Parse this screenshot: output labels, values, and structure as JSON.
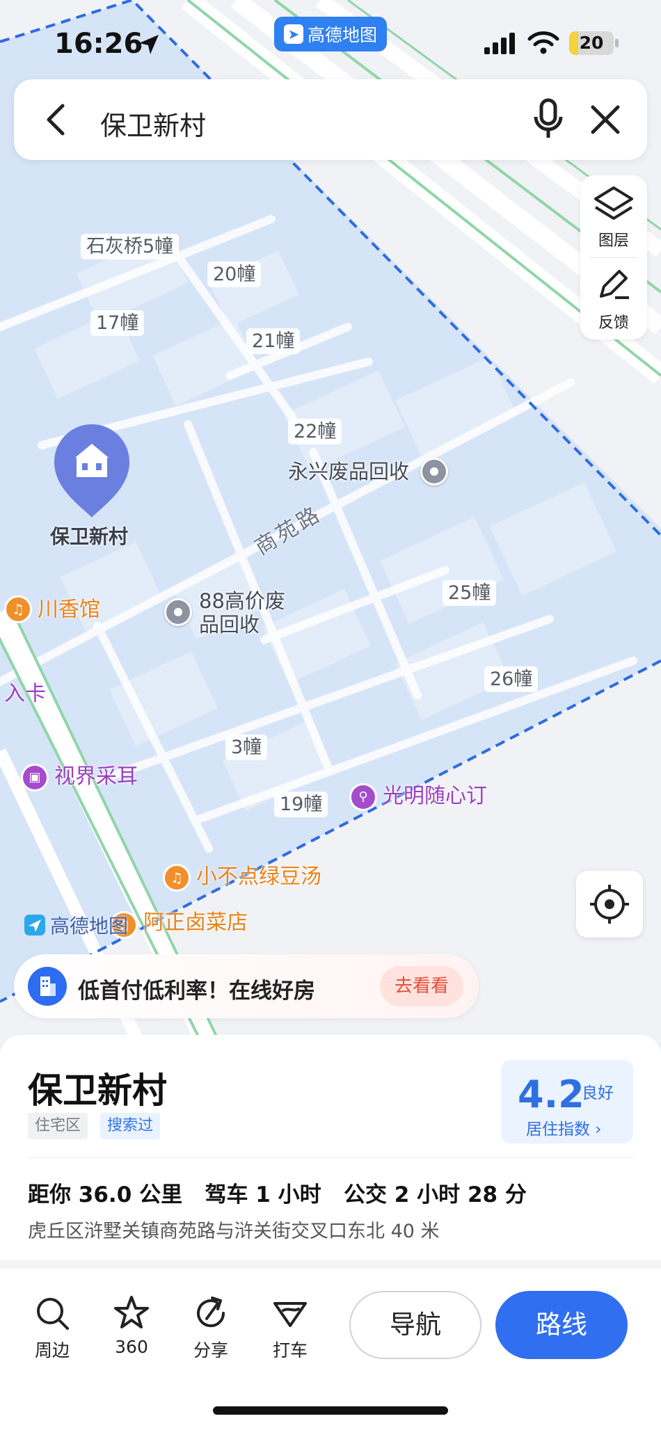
{
  "status_bar": {
    "time": "16:26",
    "app_badge": "高德地图",
    "battery": "20",
    "battery_level": 0.2
  },
  "search": {
    "query": "保卫新村"
  },
  "side_controls": {
    "layers": "图层",
    "feedback": "反馈"
  },
  "map": {
    "buildings": [
      "石灰桥5幢",
      "20幢",
      "17幢",
      "21幢",
      "22幢",
      "25幢",
      "26幢",
      "3幢",
      "19幢"
    ],
    "road_name": "商苑路",
    "pois": {
      "recycle1": "永兴废品回收",
      "recycle2_line1": "88高价废",
      "recycle2_line2": "品回收",
      "restaurant1": "川香馆",
      "edge_label": "入卡",
      "shop1": "视界采耳",
      "shop2": "光明随心订",
      "restaurant2": "小不点绿豆汤",
      "restaurant3": "阿正卤菜店"
    },
    "pin_label": "保卫新村",
    "watermark": "高德地图"
  },
  "ad": {
    "text": "低首付低利率！在线好房",
    "button": "去看看"
  },
  "place": {
    "name": "保卫新村",
    "tags": [
      "住宅区",
      "搜索过"
    ],
    "score": "4.2",
    "score_level": "良好",
    "score_label": "居住指数",
    "distance": "距你 36.0 公里",
    "drive": "驾车 1 小时",
    "transit": "公交 2 小时 28 分",
    "address": "虎丘区浒墅关镇商苑路与浒关街交叉口东北 40 米"
  },
  "actions": {
    "nearby": "周边",
    "panorama": "360",
    "share": "分享",
    "taxi": "打车",
    "navigate": "导航",
    "route": "路线"
  },
  "colors": {
    "accent": "#2f6ff0",
    "area_fill": "#d6e4f7",
    "boundary": "#2d6be0"
  }
}
